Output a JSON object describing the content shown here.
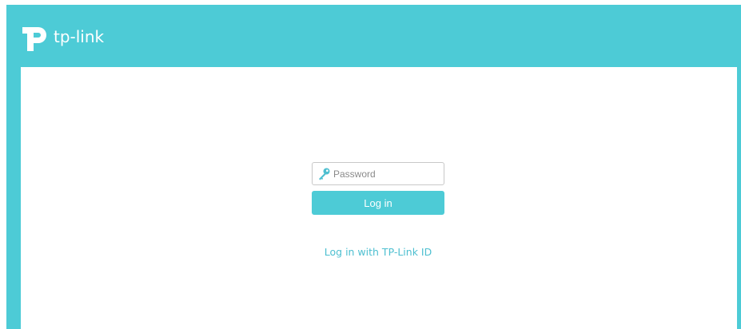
{
  "brand": {
    "logo_text": "tp-link",
    "accent_color": "#4dcbd6"
  },
  "login": {
    "password_placeholder": "Password",
    "password_value": "",
    "login_button_label": "Log in",
    "tplink_id_link": "Log in with TP-Link ID"
  },
  "icons": {
    "logo": "tp-link-logo-icon",
    "password": "key-icon"
  }
}
